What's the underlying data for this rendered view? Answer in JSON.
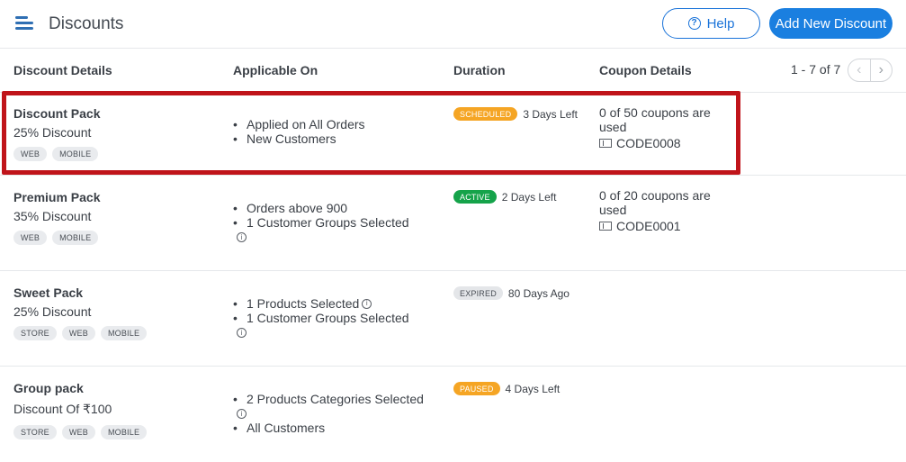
{
  "header": {
    "title": "Discounts",
    "help_label": "Help",
    "add_label": "Add New Discount",
    "accent_color": "#1a7fe0"
  },
  "table": {
    "columns": [
      "Discount Details",
      "Applicable On",
      "Duration",
      "Coupon Details"
    ],
    "pagination": "1 - 7 of 7",
    "rows": [
      {
        "name": "Discount Pack",
        "discount": "25% Discount",
        "tags": [
          "WEB",
          "MOBILE"
        ],
        "applicable": [
          "Applied on All Orders",
          "New Customers"
        ],
        "status": "SCHEDULED",
        "duration": "3 Days Left",
        "coupon_usage": "0 of 50 coupons are used",
        "coupon_code": "CODE0008"
      },
      {
        "name": "Premium Pack",
        "discount": "35% Discount",
        "tags": [
          "WEB",
          "MOBILE"
        ],
        "applicable": [
          "Orders above 900",
          "1 Customer Groups Selected"
        ],
        "status": "ACTIVE",
        "duration": "2 Days Left",
        "coupon_usage": "0 of 20 coupons are used",
        "coupon_code": "CODE0001"
      },
      {
        "name": "Sweet Pack",
        "discount": "25% Discount",
        "tags": [
          "STORE",
          "WEB",
          "MOBILE"
        ],
        "applicable": [
          "1 Products Selected",
          "1 Customer Groups Selected"
        ],
        "status": "EXPIRED",
        "duration": "80 Days Ago"
      },
      {
        "name": "Group pack",
        "discount": "Discount Of ₹100",
        "tags": [
          "STORE",
          "WEB",
          "MOBILE"
        ],
        "applicable": [
          "2 Products Categories Selected",
          "All Customers"
        ],
        "status": "PAUSED",
        "duration": "4 Days Left"
      }
    ]
  },
  "highlight_color": "#c0141a"
}
